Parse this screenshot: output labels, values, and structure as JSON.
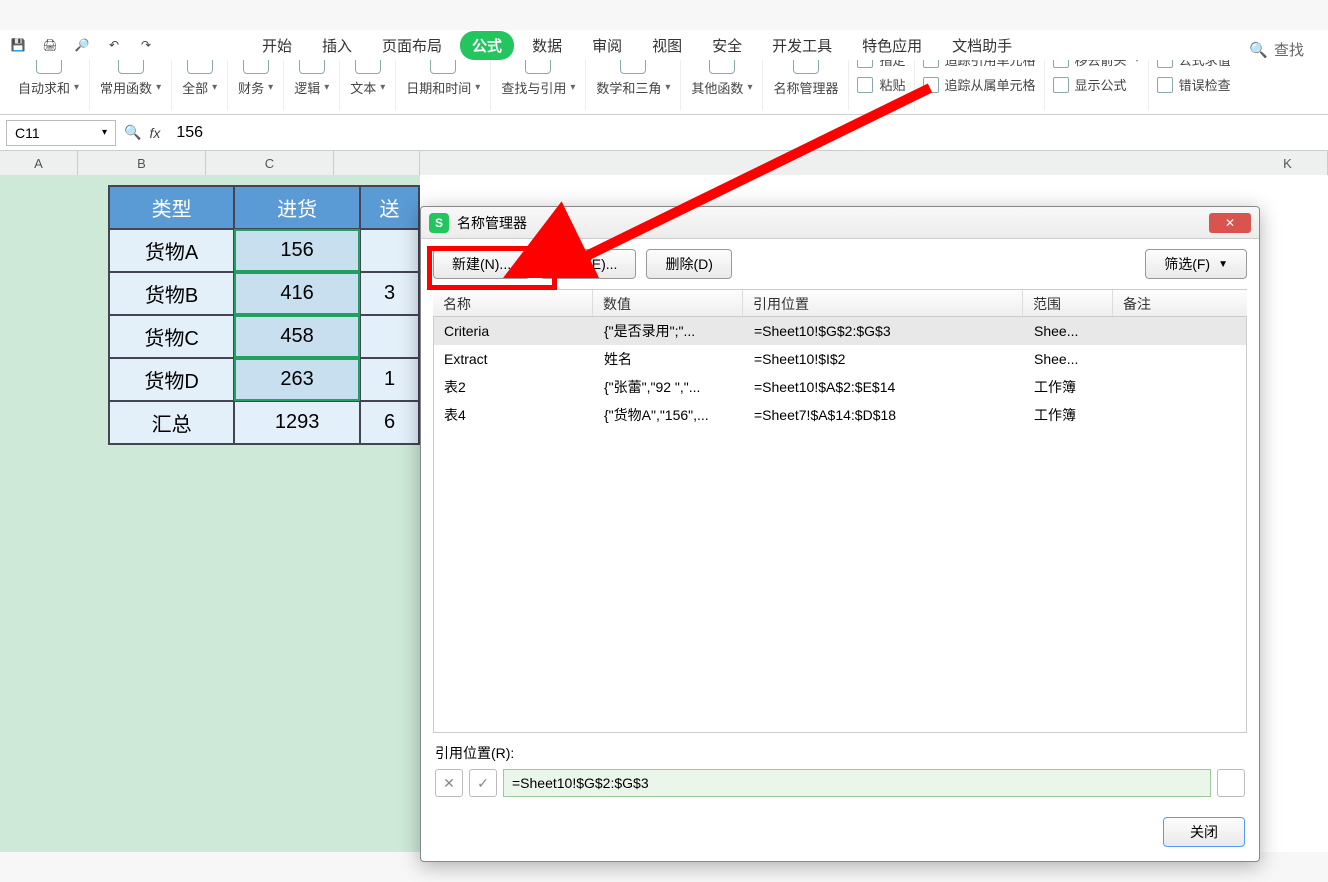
{
  "menu": {
    "tabs": [
      "开始",
      "插入",
      "页面布局",
      "公式",
      "数据",
      "审阅",
      "视图",
      "安全",
      "开发工具",
      "特色应用",
      "文档助手"
    ],
    "active_index": 3,
    "search_label": "查找"
  },
  "ribbon": {
    "groups": [
      {
        "label": "自动求和"
      },
      {
        "label": "常用函数"
      },
      {
        "label": "全部"
      },
      {
        "label": "财务"
      },
      {
        "label": "逻辑"
      },
      {
        "label": "文本"
      },
      {
        "label": "日期和时间"
      },
      {
        "label": "查找与引用"
      },
      {
        "label": "数学和三角"
      },
      {
        "label": "其他函数"
      }
    ],
    "name_mgr": "名称管理器",
    "paste": "粘贴",
    "right_col": {
      "r1a": "追踪引用单元格",
      "r1b": "移去箭头",
      "r1c": "公式求值",
      "r2a": "追踪从属单元格",
      "r2b": "显示公式",
      "r2c": "错误检查",
      "r0a": "指定"
    }
  },
  "formula": {
    "cell_ref": "C11",
    "value": "156"
  },
  "cols": [
    "A",
    "B",
    "C",
    "K"
  ],
  "table": {
    "headers": [
      "类型",
      "进货",
      "送"
    ],
    "rows": [
      {
        "name": "货物A",
        "val": "156",
        "d": ""
      },
      {
        "name": "货物B",
        "val": "416",
        "d": "3"
      },
      {
        "name": "货物C",
        "val": "458",
        "d": ""
      },
      {
        "name": "货物D",
        "val": "263",
        "d": "1"
      }
    ],
    "sum_label": "汇总",
    "sum_val": "1293",
    "sum_d": "6"
  },
  "dialog": {
    "title": "名称管理器",
    "btn_new": "新建(N)...",
    "btn_edit": "编辑(E)...",
    "btn_delete": "删除(D)",
    "btn_filter": "筛选(F)",
    "cols": {
      "name": "名称",
      "val": "数值",
      "ref": "引用位置",
      "scope": "范围",
      "note": "备注"
    },
    "rows": [
      {
        "name": "Criteria",
        "val": "{\"是否录用\";\"...",
        "ref": "=Sheet10!$G$2:$G$3",
        "scope": "Shee...",
        "note": ""
      },
      {
        "name": "Extract",
        "val": "姓名",
        "ref": "=Sheet10!$I$2",
        "scope": "Shee...",
        "note": ""
      },
      {
        "name": "表2",
        "val": "{\"张蕾\",\"92 \",\"...",
        "ref": "=Sheet10!$A$2:$E$14",
        "scope": "工作簿",
        "note": ""
      },
      {
        "name": "表4",
        "val": "{\"货物A\",\"156\",...",
        "ref": "=Sheet7!$A$14:$D$18",
        "scope": "工作簿",
        "note": ""
      }
    ],
    "ref_label": "引用位置(R):",
    "ref_value": "=Sheet10!$G$2:$G$3",
    "close": "关闭"
  }
}
